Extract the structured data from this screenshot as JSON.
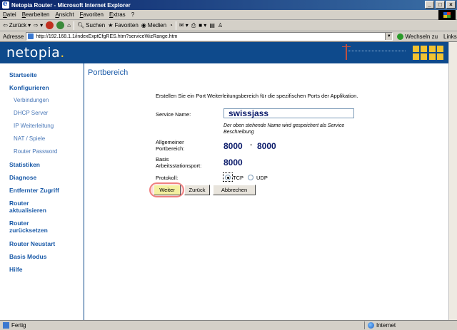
{
  "window": {
    "title": "Netopia Router - Microsoft Internet Explorer",
    "btn_min": "_",
    "btn_max": "□",
    "btn_close": "×"
  },
  "menu": [
    "Datei",
    "Bearbeiten",
    "Ansicht",
    "Favoriten",
    "Extras",
    "?"
  ],
  "toolbar": {
    "back": "Zurück",
    "search": "Suchen",
    "favorites": "Favoriten",
    "media": "Medien"
  },
  "address": {
    "label": "Adresse",
    "url": "http://192.168.1.1/indexExptCfgRES.htm?serviceWizRange.htm",
    "go": "Wechseln zu",
    "links": "Links"
  },
  "brand": {
    "logo": "netopia",
    "logo_dot": "."
  },
  "sidebar": {
    "startseite": "Startseite",
    "konfigurieren": "Konfigurieren",
    "verbindungen": "Verbindungen",
    "dhcp": "DHCP Server",
    "ip_weiterleitung": "IP Weiterleitung",
    "nat": "NAT / Spiele",
    "router_password": "Router Password",
    "statistiken": "Statistiken",
    "diagnose": "Diagnose",
    "entfernter": "Entfernter Zugriff",
    "aktualisieren_1": "Router",
    "aktualisieren_2": "aktualisieren",
    "zuruecksetzen_1": "Router",
    "zuruecksetzen_2": "zurücksetzen",
    "neustart": "Router Neustart",
    "basis": "Basis Modus",
    "hilfe": "Hilfe"
  },
  "form": {
    "title": "Portbereich",
    "intro": "Erstellen Sie ein Port Weiterleitungsbereich für die spezifischen Ports der Applikation.",
    "service_label": "Service Name:",
    "service_value": "swissjass",
    "help_1": "Der oben stehende Name wird gespeichert als Service",
    "help_2": "Beschreibung",
    "range_label_1": "Allgemeiner",
    "range_label_2": "Portbereich:",
    "range_start": "8000",
    "range_dash": "-",
    "range_end": "8000",
    "base_label_1": "Basis",
    "base_label_2": "Arbeitsstationsport:",
    "base_port": "8000",
    "protocol_label": "Protokoll:",
    "protocol_tcp": "TCP",
    "protocol_udp": "UDP",
    "protocol_selected": "TCP",
    "btn_next": "Weiter",
    "btn_back": "Zurück",
    "btn_cancel": "Abbrechen"
  },
  "status": {
    "left": "Fertig",
    "zone": "Internet"
  },
  "colors": {
    "brand_blue": "#0e4a8c",
    "link_blue": "#1a5aa8",
    "accent_yellow": "#f2c230",
    "highlight": "#f08080"
  }
}
